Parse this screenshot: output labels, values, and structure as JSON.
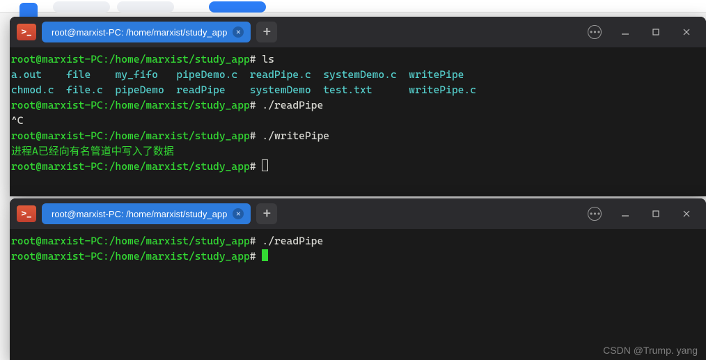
{
  "tab_title": "root@marxist-PC: /home/marxist/study_app",
  "icon_glyph": ">_",
  "watermark": "CSDN @Trump. yang",
  "top_term": {
    "l0": {
      "prompt_user": "root@marxist-PC",
      "prompt_path": ":/home/marxist/study_app",
      "hash": "#",
      "cmd": " ls"
    },
    "ls1": "a.out    file    my_fifo   pipeDemo.c  readPipe.c  systemDemo.c  writePipe",
    "ls2": "chmod.c  file.c  pipeDemo  readPipe    systemDemo  test.txt      writePipe.c",
    "l1": {
      "prompt_user": "root@marxist-PC",
      "prompt_path": ":/home/marxist/study_app",
      "hash": "#",
      "cmd": " ./readPipe"
    },
    "ctrlc": "^C",
    "l2": {
      "prompt_user": "root@marxist-PC",
      "prompt_path": ":/home/marxist/study_app",
      "hash": "#",
      "cmd": " ./writePipe"
    },
    "output_cn": "进程A已经向有名管道中写入了数据",
    "l3": {
      "prompt_user": "root@marxist-PC",
      "prompt_path": ":/home/marxist/study_app",
      "hash": "#",
      "cmd": " "
    }
  },
  "bottom_term": {
    "l0": {
      "prompt_user": "root@marxist-PC",
      "prompt_path": ":/home/marxist/study_app",
      "hash": "#",
      "cmd": " ./readPipe"
    },
    "l1": {
      "prompt_user": "root@marxist-PC",
      "prompt_path": ":/home/marxist/study_app",
      "hash": "#",
      "cmd": " "
    }
  }
}
